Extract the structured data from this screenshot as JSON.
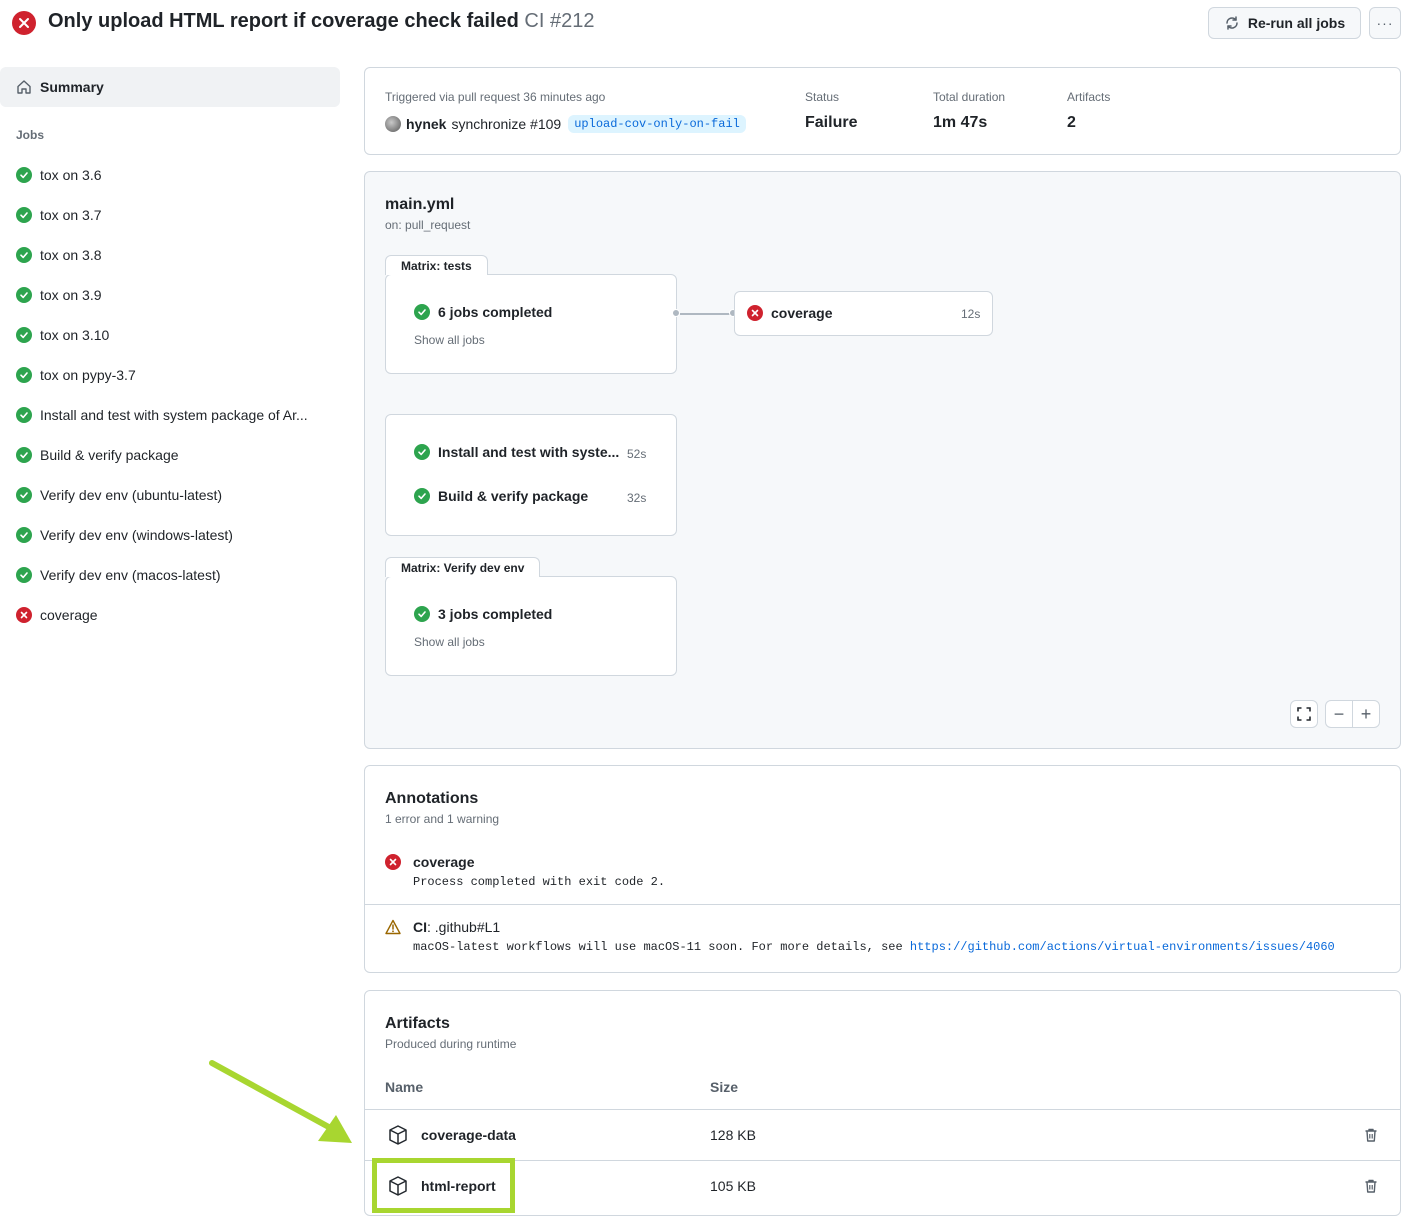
{
  "header": {
    "title": "Only upload HTML report if coverage check failed",
    "run_label": "CI #212",
    "status_icon": "x-circle-fill-icon",
    "rerun_label": "Re-run all jobs",
    "more_label": "···"
  },
  "sidebar": {
    "summary_label": "Summary",
    "jobs_heading": "Jobs",
    "jobs": [
      {
        "label": "tox on 3.6",
        "status": "success"
      },
      {
        "label": "tox on 3.7",
        "status": "success"
      },
      {
        "label": "tox on 3.8",
        "status": "success"
      },
      {
        "label": "tox on 3.9",
        "status": "success"
      },
      {
        "label": "tox on 3.10",
        "status": "success"
      },
      {
        "label": "tox on pypy-3.7",
        "status": "success"
      },
      {
        "label": "Install and test with system package of Ar...",
        "status": "success"
      },
      {
        "label": "Build & verify package",
        "status": "success"
      },
      {
        "label": "Verify dev env (ubuntu-latest)",
        "status": "success"
      },
      {
        "label": "Verify dev env (windows-latest)",
        "status": "success"
      },
      {
        "label": "Verify dev env (macos-latest)",
        "status": "success"
      },
      {
        "label": "coverage",
        "status": "failure"
      }
    ]
  },
  "summary": {
    "triggered_text": "Triggered via pull request 36 minutes ago",
    "actor": "hynek",
    "event_text": "synchronize #109",
    "branch": "upload-cov-only-on-fail",
    "status_label": "Status",
    "status_value": "Failure",
    "duration_label": "Total duration",
    "duration_value": "1m 47s",
    "artifacts_label": "Artifacts",
    "artifacts_value": "2"
  },
  "graph": {
    "file": "main.yml",
    "trigger": "on: pull_request",
    "matrix_tests": {
      "tab": "Matrix: tests",
      "status_text": "6 jobs completed",
      "link": "Show all jobs"
    },
    "coverage_job": {
      "label": "coverage",
      "duration": "12s"
    },
    "standalone_jobs": [
      {
        "label": "Install and test with syste...",
        "duration": "52s"
      },
      {
        "label": "Build & verify package",
        "duration": "32s"
      }
    ],
    "matrix_dev": {
      "tab": "Matrix: Verify dev env",
      "status_text": "3 jobs completed",
      "link": "Show all jobs"
    },
    "zoom_out": "−",
    "zoom_in": "+"
  },
  "annotations": {
    "title": "Annotations",
    "subtitle": "1 error and 1 warning",
    "items": [
      {
        "type": "error",
        "title": "coverage",
        "message": "Process completed with exit code 2."
      },
      {
        "type": "warning",
        "title_bold": "CI",
        "title_rest": ": .github#L1",
        "message": "macOS-latest workflows will use macOS-11 soon. For more details, see ",
        "link": "https://github.com/actions/virtual-environments/issues/4060"
      }
    ]
  },
  "artifacts": {
    "title": "Artifacts",
    "subtitle": "Produced during runtime",
    "col_name": "Name",
    "col_size": "Size",
    "rows": [
      {
        "name": "coverage-data",
        "size": "128 KB"
      },
      {
        "name": "html-report",
        "size": "105 KB"
      }
    ]
  },
  "colors": {
    "success": "#2da44e",
    "failure": "#cf222e",
    "highlight": "#a8d630",
    "link": "#0969da"
  }
}
